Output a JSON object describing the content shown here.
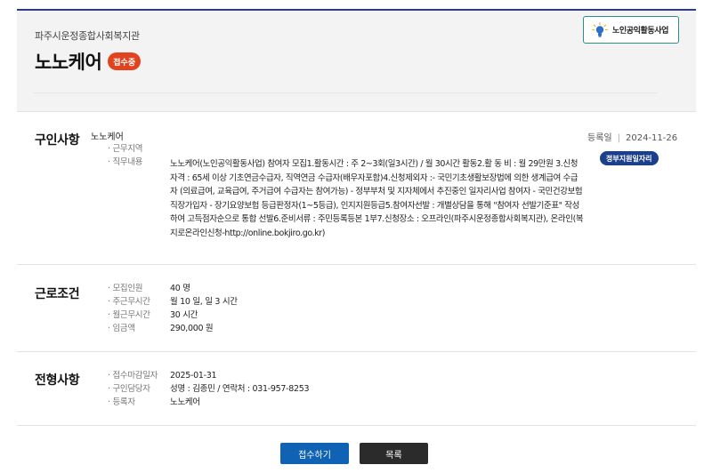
{
  "header": {
    "org_name": "파주시운정종합사회복지관",
    "title": "노노케어",
    "status": "접수중",
    "program_badge": "노인공익활동사업",
    "program_icon": "lightbulb-icon"
  },
  "recruit": {
    "section_title": "구인사항",
    "company": "노노케어",
    "reg_label": "등록일",
    "reg_date": "2024-11-26",
    "gov_badge": "정부지원일자리",
    "rows": [
      {
        "label": "· 근무지역",
        "value": ""
      },
      {
        "label": "· 직무내용",
        "value": ""
      }
    ],
    "description": "노노케어(노인공익활동사업) 참여자 모집1.활동시간 : 주 2~3회(일3시간) / 월 30시간 활동2.활 동 비 : 월 29만원 3.신청자격 : 65세 이상 기초연금수급자, 직역연금 수급자(배우자포함)4.신청제외자 :- 국민기초생활보장법에 의한 생계급여 수급자 (의료급여, 교육급여, 주거급여 수급자는 참여가능) - 정부부처 및 지자체에서 추진중인 일자리사업 참여자 - 국민건강보험 직장가입자 - 장기요양보험 등급판정자(1~5등급), 인지지원등급5.참여자선발 : 개별상담을 통해 \"참여자 선발기준표\" 작성하여 고득점자순으로 통합 선발6.준비서류 : 주민등록등본 1부7.신청장소 : 오프라인(파주시운정종합사회복지관), 온라인(복지로온라인신청-http://online.bokjiro.go.kr)"
  },
  "conditions": {
    "section_title": "근로조건",
    "rows": [
      {
        "label": "· 모집인원",
        "value": "40 명"
      },
      {
        "label": "· 주근무시간",
        "value": "월 10 일, 일 3 시간"
      },
      {
        "label": "· 월근무시간",
        "value": "30 시간"
      },
      {
        "label": "· 임금액",
        "value": "290,000 원"
      }
    ]
  },
  "screening": {
    "section_title": "전형사항",
    "rows": [
      {
        "label": "· 접수마감일자",
        "value": "2025-01-31"
      },
      {
        "label": "· 구인담당자",
        "value": "성명 : 김종민 / 연락처 : 031-957-8253"
      },
      {
        "label": "· 등록자",
        "value": "노노케어"
      }
    ]
  },
  "buttons": {
    "apply": "접수하기",
    "list": "목록"
  },
  "colors": {
    "accent_blue": "#0f62b4",
    "status_red": "#e2431f",
    "badge_navy": "#1c3f8c",
    "dark_button": "#2b2b2b"
  }
}
